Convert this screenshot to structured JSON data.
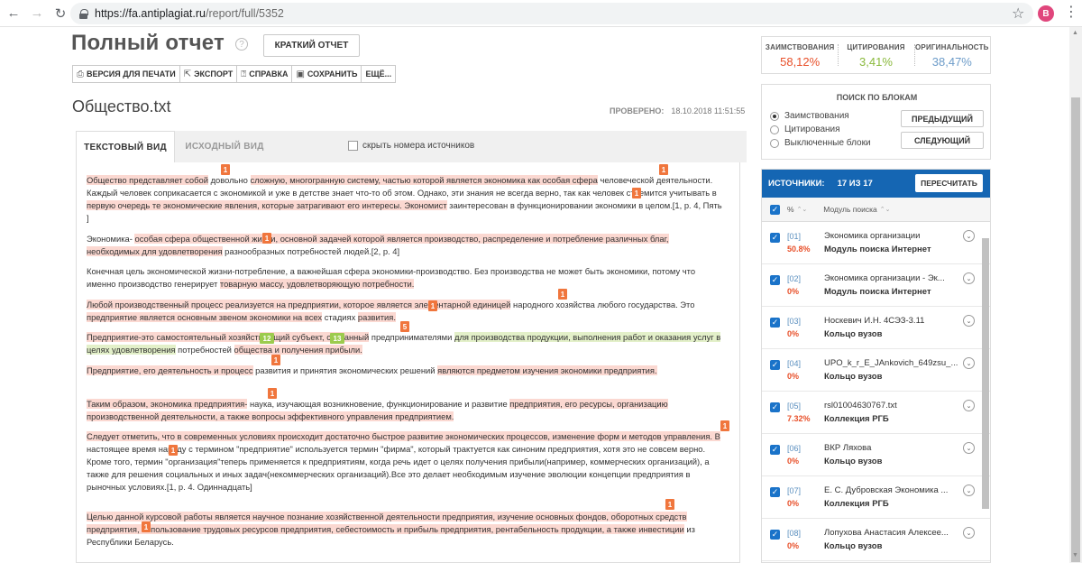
{
  "browser": {
    "url_host": "https://fa.antiplagiat.ru",
    "url_path": "/report/full/5352",
    "profile_letter": "B"
  },
  "header": {
    "title": "Полный отчет",
    "help": "?",
    "short_report_button": "КРАТКИЙ ОТЧЕТ"
  },
  "toolbar": {
    "print": "ВЕРСИЯ ДЛЯ ПЕЧАТИ",
    "export": "ЭКСПОРТ",
    "help": "СПРАВКА",
    "save": "СОХРАНИТЬ",
    "more": "ЕЩЁ..."
  },
  "document": {
    "filename": "Общество.txt",
    "checked_label": "ПРОВЕРЕНО:",
    "checked_value": "18.10.2018 11:51:55"
  },
  "tabs": {
    "text_view": "ТЕКСТОВЫЙ ВИД",
    "source_view": "ИСХОДНЫЙ ВИД",
    "hide_numbers": "скрыть номера источников"
  },
  "paragraphs": {
    "p1": {
      "a": "Общество представляет собой",
      "b": " довольно ",
      "c": "сложную, многогранную систему, частью которой является экономика как особая сфера",
      "d": " человеческой деятельности. Каждый человек соприкасается с экономикой и уже в детстве знает что-то об этом. Однако, эти знания не всегда верно, так как человек стремится учитывать в ",
      "e": "первую очередь те экономические явления, которые затрагивают его интересы. Экономист",
      "f": " заинтересован в функционировании экономики в целом.[1, р. 4, Пять ]"
    },
    "p2": {
      "a": "Экономика- ",
      "b": "особая сфера общественной жизни, основной задачей которой является производство, распределение и потребление различных благ, необходимых для удовлетворения",
      "c": " разнообразных потребностей людей.[2, р. 4]"
    },
    "p3": {
      "a": "Конечная цель экономической жизни-потребление, а важнейшая сфера экономики-производство. Без производства не может быть экономики, потому что именно производство генерирует ",
      "b": "товарную массу, удовлетворяющую потребности."
    },
    "p4": {
      "a": "Любой производственный процесс реализуется на предприятии, которое является элементарной единицей",
      "b": " народного хозяйства любого государства. Это ",
      "c": "предприятие является основным звеном экономики на всех",
      "d": " стадиях ",
      "e": "развития."
    },
    "p5": {
      "a": "Предприятие-это самостоятельный хозяйствующий субъект, созданный",
      "b": " предпринимателями ",
      "c": "для производства продукции, выполнения работ и оказания услуг в целях удовлетворения",
      "d": " потребностей ",
      "e": "общества и получения прибыли."
    },
    "p6": {
      "a": "Предприятие, его деятельность и процесс",
      "b": " развития и принятия экономических решений ",
      "c": "являются предметом изучения экономики предприятия."
    },
    "p7": {
      "a": "Таким образом, экономика предприятия-",
      "b": " наука, изучающая возникновение, функционирование и развитие ",
      "c": "предприятия, его ресурсы, организацию производственной деятельности, а также вопросы эффективного управления предприятием."
    },
    "p8": {
      "a": "Следует отметить, что в современных условиях происходит достаточно быстрое развитие экономических процессов, изменение форм и методов управления. В",
      "b": " настоящее время наряду с термином \"предприятие\" используется термин \"фирма\", который трактуется как синоним предприятия, хотя это не совсем",
      "c": " верно. Кроме того, термин \"организация\"теперь применяется к предприятиям, когда речь идет о целях получения прибыли(например, коммерческих организаций), а также для решения социальных и иных задач(некоммерческих организаций).Все это делает необходимым изучение эволюции концепции предприятия в рыночных условиях.[1, р. 4. Одиннадцать]"
    },
    "p9": {
      "a": "Целью данной курсовой работы является научное познание хозяйственной деятельности предприятия, изучение основных фондов,",
      "b": " оборотных средств предприятия, использование трудовых ресурсов предприятия, себестоимость и прибыль предприятия, рентабельность продукции, а также инвестиции",
      "c": " из Республики Беларусь."
    }
  },
  "markers": {
    "m1": "1",
    "m2": "1",
    "m3": "1",
    "m4": "1",
    "m5": "1",
    "m6": "1",
    "m7": "12",
    "m8": "13",
    "m9": "5",
    "m10": "1",
    "m11": "1",
    "m12": "1",
    "m13": "1",
    "m14": "1",
    "m15": "1"
  },
  "stats": {
    "borrowed_label": "ЗАИМСТВОВАНИЯ",
    "borrowed_value": "58,12%",
    "citations_label": "ЦИТИРОВАНИЯ",
    "citations_value": "3,41%",
    "original_label": "ОРИГИНАЛЬНОСТЬ",
    "original_value": "38,47%"
  },
  "colors": {
    "borrowed": "#e8502a",
    "citations": "#8ab93c",
    "original": "#6d9cc9",
    "sources_header": "#1566b3"
  },
  "block_search": {
    "title": "ПОИСК ПО БЛОКАМ",
    "opt1": "Заимствования",
    "opt2": "Цитирования",
    "opt3": "Выключенные блоки",
    "prev": "ПРЕДЫДУЩИЙ",
    "next": "СЛЕДУЮЩИЙ"
  },
  "sources": {
    "label": "ИСТОЧНИКИ:",
    "count": "17 ИЗ 17",
    "recount": "ПЕРЕСЧИТАТЬ",
    "col_pct": "%",
    "col_module": "Модуль поиска",
    "rows": [
      {
        "num": "[01]",
        "pct": "50.8%",
        "name": "Экономика организации",
        "module": "Модуль поиска Интернет"
      },
      {
        "num": "[02]",
        "pct": "0%",
        "name": "Экономика организации - Эк...",
        "module": "Модуль поиска Интернет"
      },
      {
        "num": "[03]",
        "pct": "0%",
        "name": "Носкевич И.Н. 4СЭЗ-3.11",
        "module": "Кольцо вузов"
      },
      {
        "num": "[04]",
        "pct": "0%",
        "name": "UPO_k_r_E_JAnkovich_649zsu_...",
        "module": "Кольцо вузов"
      },
      {
        "num": "[05]",
        "pct": "7.32%",
        "name": "rsl01004630767.txt",
        "module": "Коллекция РГБ"
      },
      {
        "num": "[06]",
        "pct": "0%",
        "name": "ВКР Ляхова",
        "module": "Кольцо вузов"
      },
      {
        "num": "[07]",
        "pct": "0%",
        "name": "Е. С. Дубровская Экономика ...",
        "module": "Коллекция РГБ"
      },
      {
        "num": "[08]",
        "pct": "0%",
        "name": "Лопухова Анастасия Алексее...",
        "module": "Кольцо вузов"
      }
    ]
  }
}
